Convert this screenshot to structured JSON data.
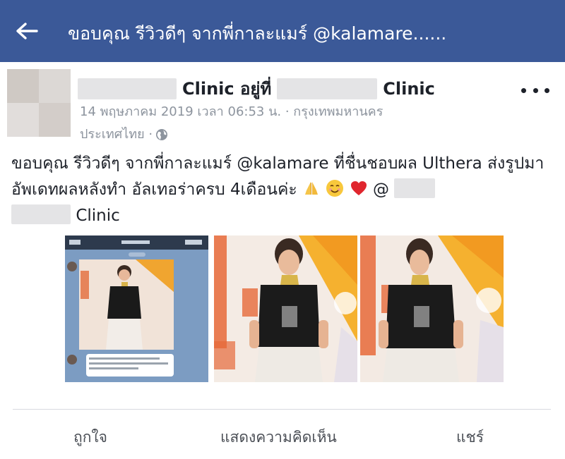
{
  "topbar": {
    "title": "ขอบคุณ รีวิวดีๆ จากพี่กาละแมร์ @kalamare......",
    "back_icon": "arrow-left-icon"
  },
  "post": {
    "page_name_part1": "Clinic อยู่ที่",
    "page_name_part2": "Clinic",
    "meta_line1": "14 พฤษภาคม 2019 เวลา 06:53 น. · กรุงเทพมหานคร",
    "meta_line2": "ประเทศไทย ·",
    "privacy_icon": "globe-icon",
    "text_part1": "ขอบคุณ รีวิวดีๆ จากพี่กาละแมร์ @kalamare ที่ชื่นชอบผล Ulthera ส่งรูปมาอัพเดทผลหลังทำ อัลเทอร่าครบ 4เดือนค่ะ",
    "text_at": "@",
    "text_part2": "Clinic",
    "emojis": [
      "folded-hands",
      "smiling-face",
      "red-heart"
    ]
  },
  "actions": {
    "like": "ถูกใจ",
    "comment": "แสดงความคิดเห็น",
    "share": "แชร์"
  },
  "colors": {
    "topbar": "#3b5998",
    "meta": "#8d949e",
    "text": "#1d2129"
  }
}
